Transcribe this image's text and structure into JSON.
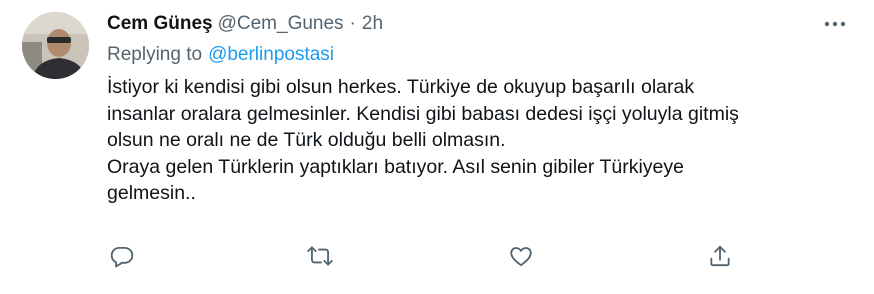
{
  "tweet": {
    "name": "Cem Güneş",
    "handle": "@Cem_Gunes",
    "separator": "·",
    "time": "2h",
    "replying_prefix": "Replying to",
    "replying_to": "@berlinpostasi",
    "lines": [
      "İstiyor ki kendisi gibi olsun herkes. Türkiye de okuyup başarılı olarak",
      "insanlar oralara gelmesinler. Kendisi gibi babası dedesi işçi yoluyla gitmiş",
      "olsun ne oralı ne de Türk olduğu belli olmasın.",
      "Oraya gelen Türklerin yaptıkları batıyor. Asıl senin gibiler Türkiyeye",
      "gelmesin.."
    ]
  },
  "icons": {
    "more": "more-horizontal-icon",
    "reply": "reply-icon",
    "retweet": "retweet-icon",
    "like": "like-icon",
    "share": "share-icon"
  },
  "colors": {
    "text": "#0f1419",
    "secondary": "#536471",
    "link": "#1d9bf0"
  }
}
